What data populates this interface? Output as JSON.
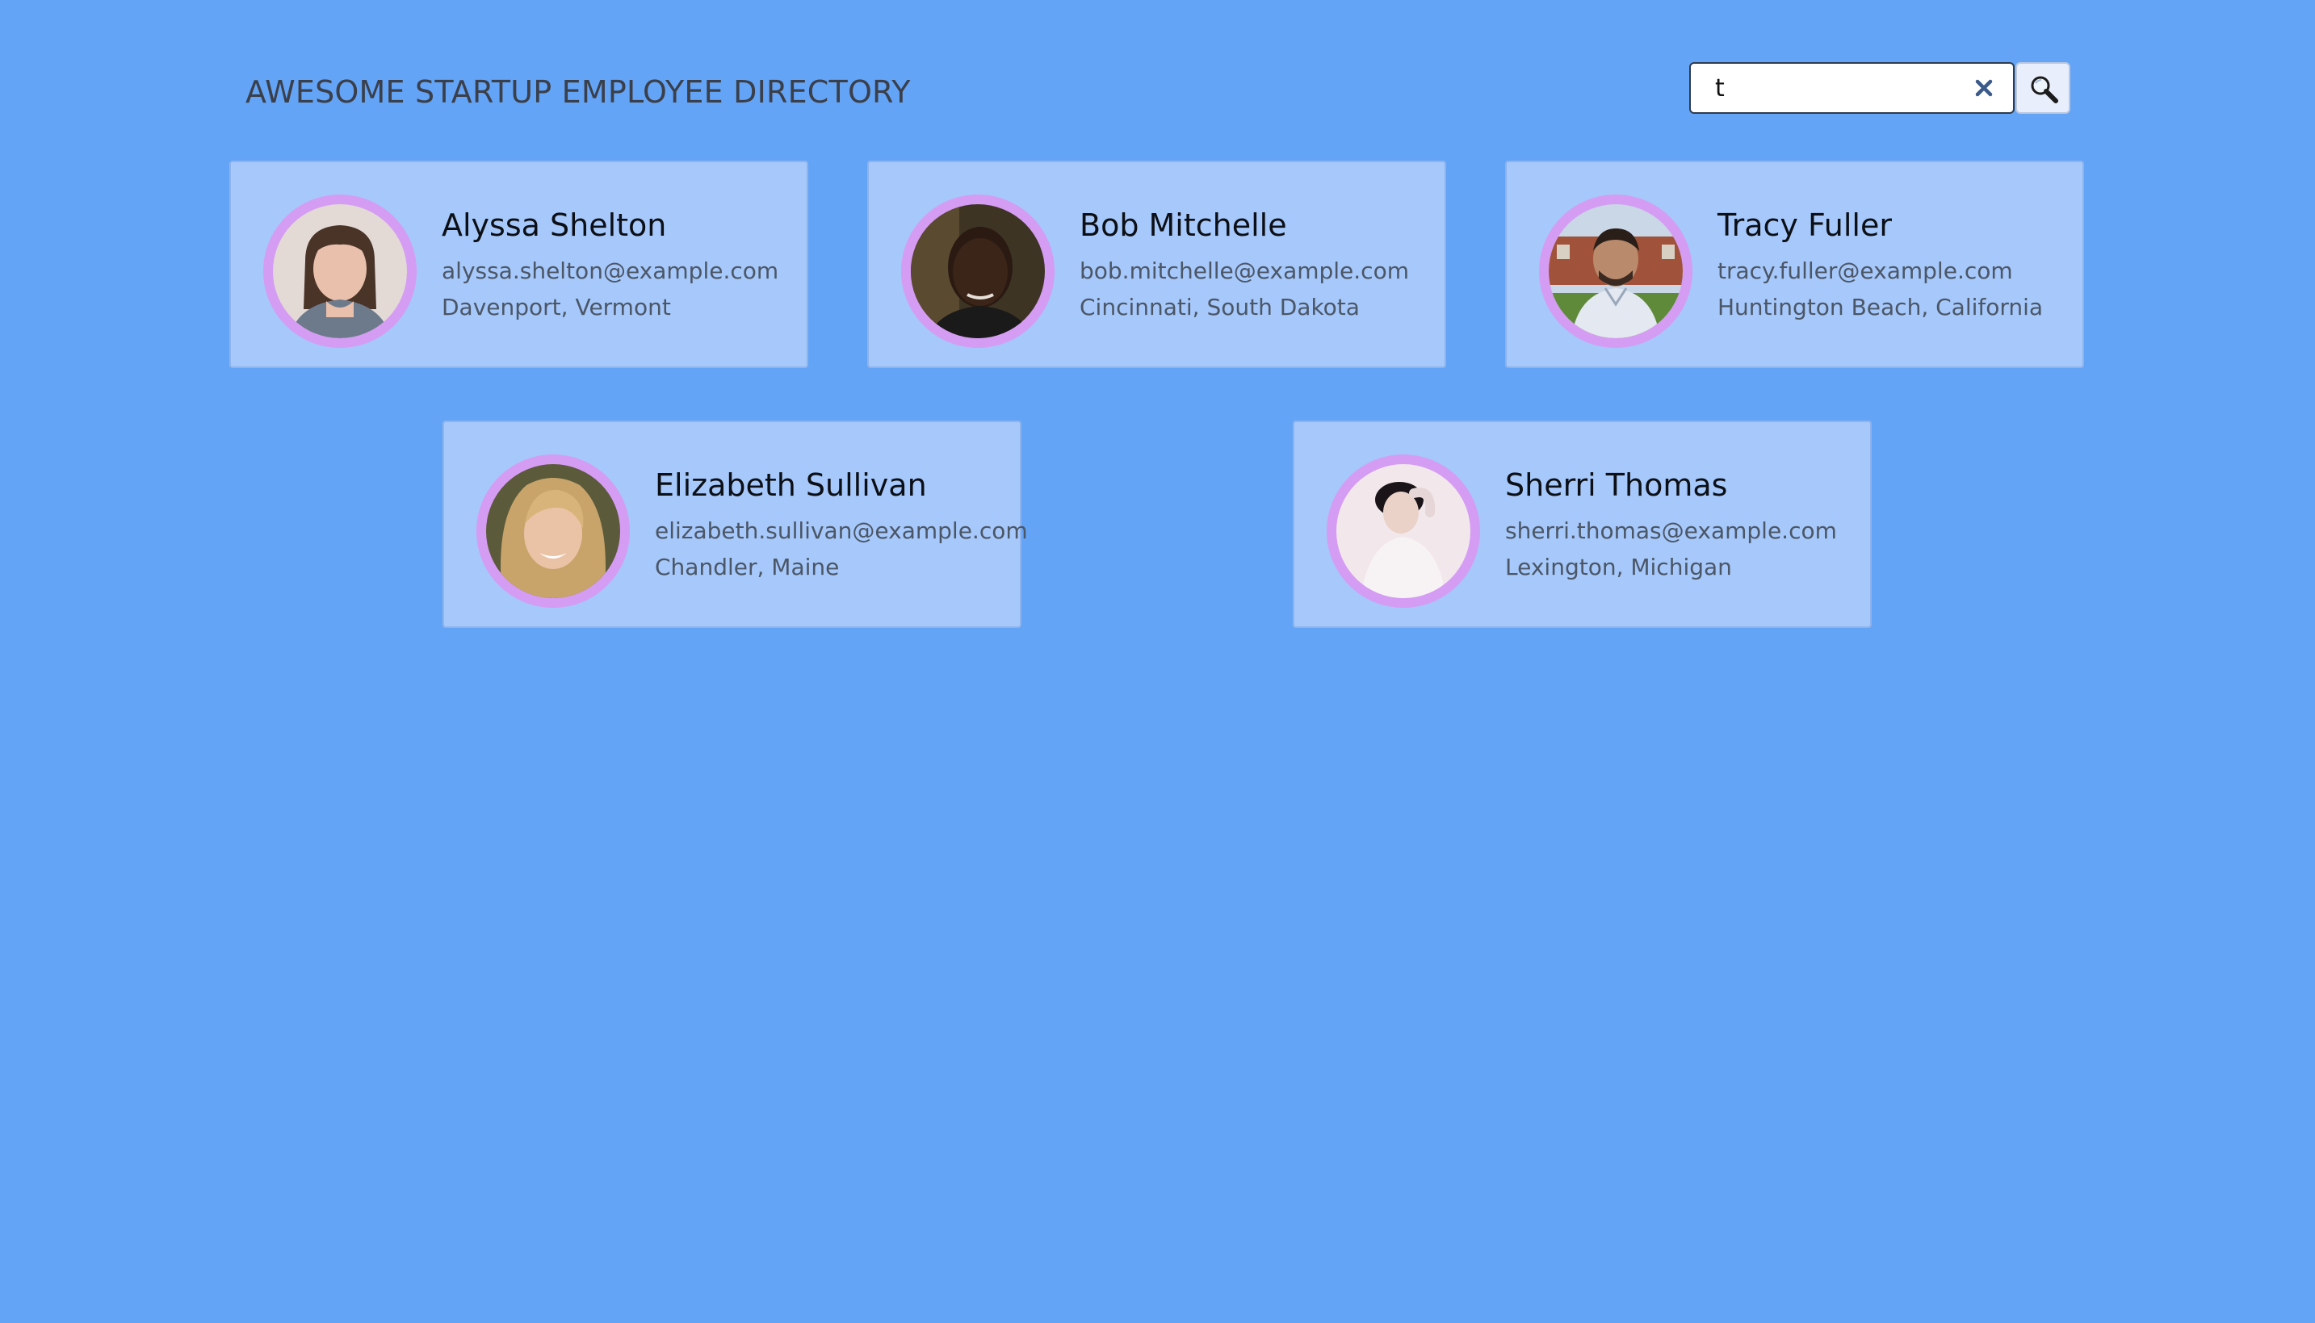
{
  "header": {
    "title": "AWESOME STARTUP EMPLOYEE DIRECTORY"
  },
  "search": {
    "value": "t",
    "clear_icon": "close-icon",
    "button_icon": "magnifier-icon"
  },
  "colors": {
    "background": "#64a4f6",
    "card": "#a6c8fa",
    "avatar_ring": "#d59cf3"
  },
  "employees": [
    {
      "name": "Alyssa Shelton",
      "email": "alyssa.shelton@example.com",
      "location": "Davenport, Vermont",
      "avatar_icon": "employee-photo"
    },
    {
      "name": "Bob Mitchelle",
      "email": "bob.mitchelle@example.com",
      "location": "Cincinnati, South Dakota",
      "avatar_icon": "employee-photo"
    },
    {
      "name": "Tracy Fuller",
      "email": "tracy.fuller@example.com",
      "location": "Huntington Beach, California",
      "avatar_icon": "employee-photo"
    },
    {
      "name": "Elizabeth Sullivan",
      "email": "elizabeth.sullivan@example.com",
      "location": "Chandler, Maine",
      "avatar_icon": "employee-photo"
    },
    {
      "name": "Sherri Thomas",
      "email": "sherri.thomas@example.com",
      "location": "Lexington, Michigan",
      "avatar_icon": "employee-photo"
    }
  ]
}
